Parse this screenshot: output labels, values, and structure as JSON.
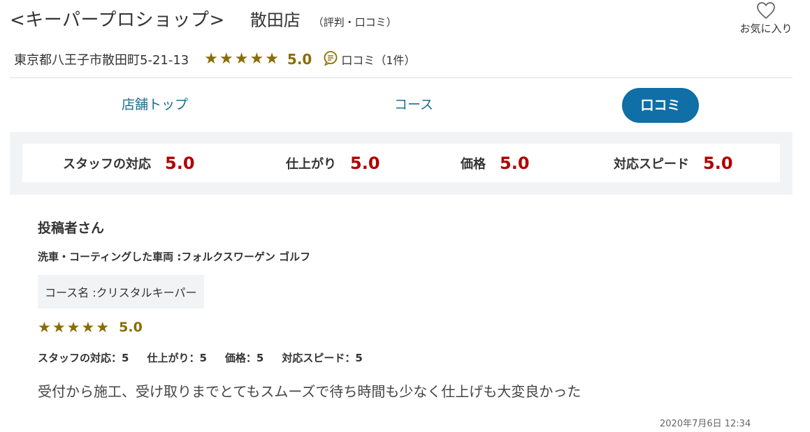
{
  "header": {
    "shop_name": "<キーパープロショップ>",
    "branch": "散田店",
    "subtitle": "（評判・口コミ）",
    "favorite_label": "お気に入り"
  },
  "info": {
    "address": "東京都八王子市散田町5-21-13",
    "rating": "5.0",
    "stars": 5,
    "review_link": "口コミ（1件）"
  },
  "tabs": [
    {
      "label": "店舗トップ",
      "active": false
    },
    {
      "label": "コース",
      "active": false
    },
    {
      "label": "口コミ",
      "active": true
    }
  ],
  "ratings": [
    {
      "label": "スタッフの対応",
      "value": "5.0"
    },
    {
      "label": "仕上がり",
      "value": "5.0"
    },
    {
      "label": "価格",
      "value": "5.0"
    },
    {
      "label": "対応スピード",
      "value": "5.0"
    }
  ],
  "review": {
    "reviewer": "投稿者さん",
    "vehicle": "洗車・コーティングした車両 :フォルクスワーゲン ゴルフ",
    "course": "コース名 :クリスタルキーパー",
    "rating": "5.0",
    "stars": 5,
    "breakdown": [
      "スタッフの対応：5",
      "仕上がり：5",
      "価格：5",
      "対応スピード：5"
    ],
    "comment": "受付から施工、受け取りまでとてもスムーズで待ち時間も少なく仕上げも大変良かった",
    "timestamp": "2020年7月6日 12:34"
  },
  "colors": {
    "star": "#8a6d00",
    "rating_value": "#b00000",
    "tab_link": "#1a6e8f",
    "active_tab_bg": "#0f6fa6",
    "panel_bg": "#f2f3f5"
  }
}
